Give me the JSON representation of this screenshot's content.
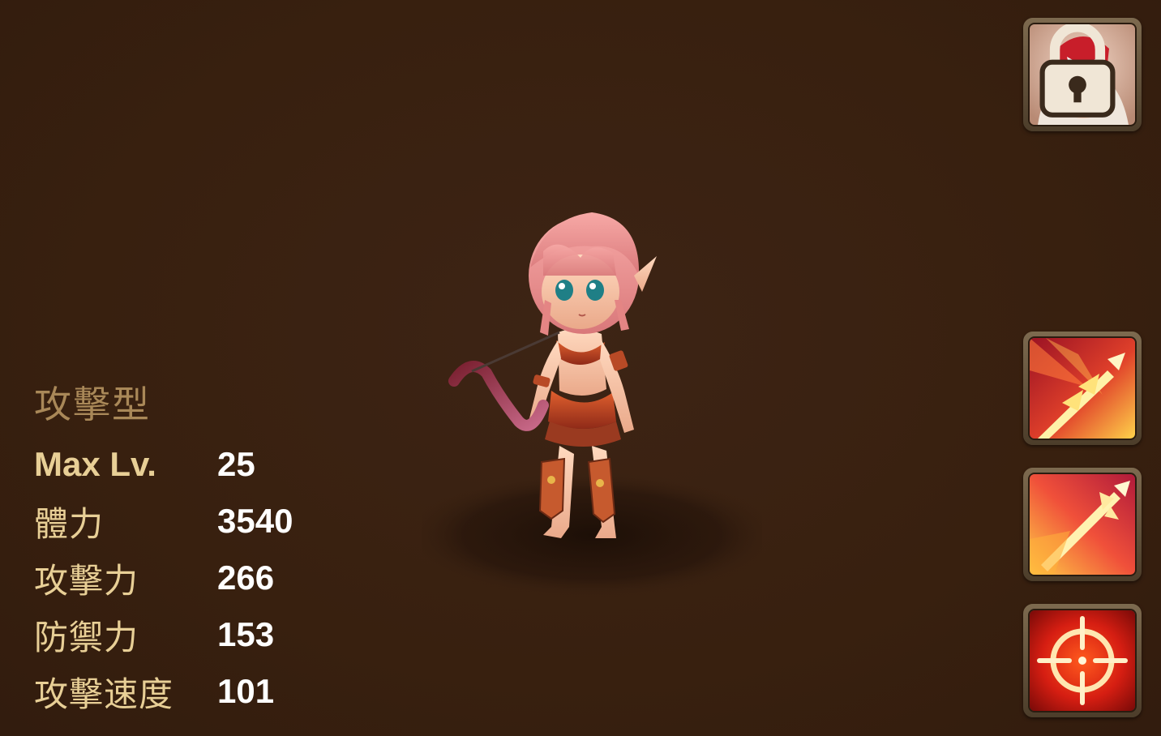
{
  "hero": {
    "type_label": "攻擊型",
    "stats": [
      {
        "label": "Max Lv.",
        "value": "25"
      },
      {
        "label": "體力",
        "value": "3540"
      },
      {
        "label": "攻擊力",
        "value": "266"
      },
      {
        "label": "防禦力",
        "value": "153"
      },
      {
        "label": "攻擊速度",
        "value": "101"
      }
    ]
  },
  "side_slots": {
    "portrait": {
      "icon": "masked-hero-portrait",
      "locked": true
    },
    "skills": [
      {
        "icon": "fire-arrow-skill-icon"
      },
      {
        "icon": "piercing-arrow-skill-icon"
      },
      {
        "icon": "crosshair-target-skill-icon"
      }
    ]
  },
  "colors": {
    "background": "#38200f",
    "type_label": "#a98858",
    "stat_label": "#e8cf96",
    "stat_value": "#ffffff",
    "slot_frame": "#7d6a4f"
  }
}
